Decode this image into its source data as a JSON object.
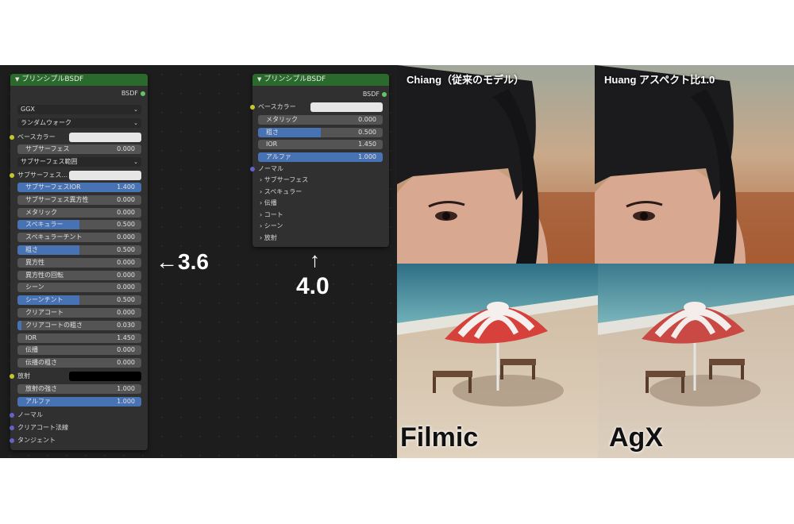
{
  "left_node": {
    "title": "プリンシプルBSDF",
    "output": "BSDF",
    "distribution": "GGX",
    "subsurface_method": "ランダムウォーク",
    "base_color_label": "ベースカラー",
    "subsurface": {
      "label": "サブサーフェス",
      "value": "0.000"
    },
    "subsurface_radius": "サブサーフェス範囲",
    "subsurface_color_label": "サブサーフェス...",
    "rows": [
      {
        "label": "サブサーフェスIOR",
        "value": "1.400",
        "fill": 1.0
      },
      {
        "label": "サブサーフェス異方性",
        "value": "0.000",
        "fill": 0
      },
      {
        "label": "メタリック",
        "value": "0.000",
        "fill": 0
      },
      {
        "label": "スペキュラー",
        "value": "0.500",
        "fill": 0.5
      },
      {
        "label": "スペキュラーチント",
        "value": "0.000",
        "fill": 0
      },
      {
        "label": "粗さ",
        "value": "0.500",
        "fill": 0.5
      },
      {
        "label": "異方性",
        "value": "0.000",
        "fill": 0
      },
      {
        "label": "異方性の回転",
        "value": "0.000",
        "fill": 0
      },
      {
        "label": "シーン",
        "value": "0.000",
        "fill": 0
      },
      {
        "label": "シーンチント",
        "value": "0.500",
        "fill": 0.5
      },
      {
        "label": "クリアコート",
        "value": "0.000",
        "fill": 0
      },
      {
        "label": "クリアコートの粗さ",
        "value": "0.030",
        "fill": 0.03
      },
      {
        "label": "IOR",
        "value": "1.450",
        "fill": 0
      },
      {
        "label": "伝播",
        "value": "0.000",
        "fill": 0
      },
      {
        "label": "伝播の粗さ",
        "value": "0.000",
        "fill": 0
      }
    ],
    "emission_label": "放射",
    "emission_strength": {
      "label": "放射の強さ",
      "value": "1.000"
    },
    "alpha": {
      "label": "アルファ",
      "value": "1.000"
    },
    "normal": "ノーマル",
    "clearcoat_normal": "クリアコート法線",
    "tangent": "タンジェント"
  },
  "right_node": {
    "title": "プリンシプルBSDF",
    "output": "BSDF",
    "base_color_label": "ベースカラー",
    "rows": [
      {
        "label": "メタリック",
        "value": "0.000",
        "fill": 0
      },
      {
        "label": "粗さ",
        "value": "0.500",
        "fill": 0.5
      },
      {
        "label": "IOR",
        "value": "1.450",
        "fill": 0
      },
      {
        "label": "アルファ",
        "value": "1.000",
        "fill": 1.0
      }
    ],
    "normal": "ノーマル",
    "panels": [
      "サブサーフェス",
      "スペキュラー",
      "伝播",
      "コート",
      "シーン",
      "放射"
    ]
  },
  "annotations": {
    "left_version": "←3.6",
    "right_arrow": "↑",
    "right_version": "4.0"
  },
  "images": {
    "top_left_label": "Chiang（従来のモデル）",
    "top_right_label": "Huang アスペクト比1.0",
    "bottom_left_caption": "Filmic",
    "bottom_right_caption": "AgX"
  },
  "colors": {
    "node_header": "#2a6b2d",
    "slider_fill": "#4772b3",
    "socket_float": "#a1a1a1",
    "socket_color": "#c7c729",
    "socket_vector": "#6363c7",
    "socket_shader": "#62c762"
  }
}
